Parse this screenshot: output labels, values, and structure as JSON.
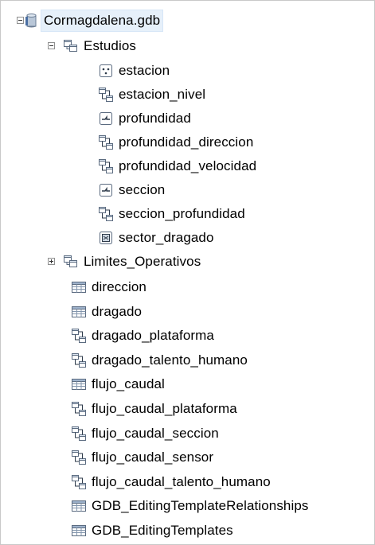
{
  "tree": {
    "root": {
      "label": "Cormagdalena.gdb",
      "icon": "geodatabase-icon",
      "expanded": true
    },
    "estudios": {
      "label": "Estudios",
      "icon": "feature-dataset-icon",
      "expanded": true,
      "children": [
        {
          "label": "estacion",
          "icon": "point-feature-class-icon"
        },
        {
          "label": "estacion_nivel",
          "icon": "relationship-class-icon"
        },
        {
          "label": "profundidad",
          "icon": "line-feature-class-icon"
        },
        {
          "label": "profundidad_direccion",
          "icon": "relationship-class-icon"
        },
        {
          "label": "profundidad_velocidad",
          "icon": "relationship-class-icon"
        },
        {
          "label": "seccion",
          "icon": "line-feature-class-icon"
        },
        {
          "label": "seccion_profundidad",
          "icon": "relationship-class-icon"
        },
        {
          "label": "sector_dragado",
          "icon": "polygon-feature-class-icon"
        }
      ]
    },
    "limites": {
      "label": "Limites_Operativos",
      "icon": "feature-dataset-icon",
      "expanded": false
    },
    "items": [
      {
        "label": "direccion",
        "icon": "table-icon"
      },
      {
        "label": "dragado",
        "icon": "table-icon"
      },
      {
        "label": "dragado_plataforma",
        "icon": "relationship-class-icon"
      },
      {
        "label": "dragado_talento_humano",
        "icon": "relationship-class-icon"
      },
      {
        "label": "flujo_caudal",
        "icon": "table-icon"
      },
      {
        "label": "flujo_caudal_plataforma",
        "icon": "relationship-class-icon"
      },
      {
        "label": "flujo_caudal_seccion",
        "icon": "relationship-class-icon"
      },
      {
        "label": "flujo_caudal_sensor",
        "icon": "relationship-class-icon"
      },
      {
        "label": "flujo_caudal_talento_humano",
        "icon": "relationship-class-icon"
      },
      {
        "label": "GDB_EditingTemplateRelationships",
        "icon": "table-icon"
      },
      {
        "label": "GDB_EditingTemplates",
        "icon": "table-icon"
      }
    ]
  }
}
